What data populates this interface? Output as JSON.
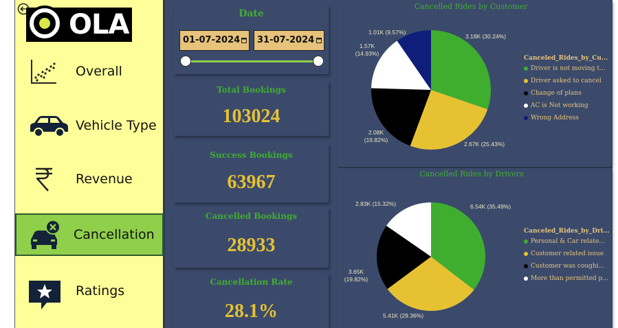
{
  "sidebar": {
    "logo_text": "OLA",
    "items": [
      {
        "label": "Overall",
        "icon": "scatter-chart-icon"
      },
      {
        "label": "Vehicle Type",
        "icon": "car-icon"
      },
      {
        "label": "Revenue",
        "icon": "rupee-icon"
      },
      {
        "label": "Cancellation",
        "icon": "car-cancel-icon",
        "active": true
      },
      {
        "label": "Ratings",
        "icon": "star-rating-icon"
      }
    ]
  },
  "date_filter": {
    "title": "Date",
    "start": "01-07-2024",
    "end": "31-07-2024"
  },
  "kpis": [
    {
      "title": "Total Bookings",
      "value": "103024"
    },
    {
      "title": "Success Bookings",
      "value": "63967"
    },
    {
      "title": "Cancelled Bookings",
      "value": "28933"
    },
    {
      "title": "Cancellation Rate",
      "value": "28.1%"
    }
  ],
  "colors": {
    "sidebar_bg": "#ffff99",
    "active_bg": "#8fcf4a",
    "panel_bg": "#3b4a6b",
    "title_green": "#3fae2f",
    "value_yellow": "#e6c233",
    "legend_text": "#e6c27a"
  },
  "chart_data": [
    {
      "type": "pie",
      "title": "Cancelled Rides by Customer",
      "legend_title": "Canceled_Rides_by_Cu...",
      "slices": [
        {
          "label": "Driver is not moving t...",
          "value": 3180,
          "display": "3.18K (30.24%)",
          "color": "#3fae2f"
        },
        {
          "label": "Driver asked to cancel",
          "value": 2670,
          "display": "2.67K (25.43%)",
          "color": "#e6c233"
        },
        {
          "label": "Change of plans",
          "value": 2080,
          "display": "2.08K (19.82%)",
          "color": "#000000"
        },
        {
          "label": "AC is Not working",
          "value": 1570,
          "display": "1.57K (14.93%)",
          "color": "#ffffff"
        },
        {
          "label": "Wrong Address",
          "value": 1010,
          "display": "1.01K (9.57%)",
          "color": "#0f1e78"
        }
      ]
    },
    {
      "type": "pie",
      "title": "Cancelled Rides by Drivers",
      "legend_title": "Canceled_Rides_by_Dri...",
      "slices": [
        {
          "label": "Personal & Car relate...",
          "value": 6540,
          "display": "6.54K (35.49%)",
          "color": "#3fae2f"
        },
        {
          "label": "Customer related issue",
          "value": 5410,
          "display": "5.41K (29.36%)",
          "color": "#e6c233"
        },
        {
          "label": "Customer was coughi...",
          "value": 3650,
          "display": "3.65K (19.82%)",
          "color": "#000000"
        },
        {
          "label": "More than permitted p...",
          "value": 2830,
          "display": "2.83K (15.32%)",
          "color": "#ffffff"
        }
      ]
    }
  ]
}
